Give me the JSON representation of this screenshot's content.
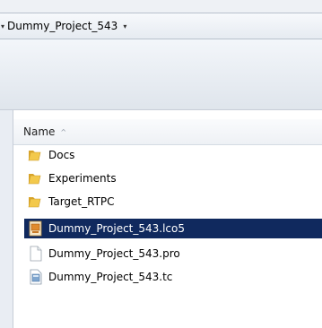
{
  "address": {
    "segment": "Dummy_Project_543",
    "lead_icon": "chevron-right-icon",
    "trail_icon": "dropdown-arrow-icon"
  },
  "columns": {
    "name_label": "Name",
    "sort_icon": "sort-ascending-icon"
  },
  "files": [
    {
      "name": "Docs",
      "icon": "folder-icon",
      "selected": false
    },
    {
      "name": "Experiments",
      "icon": "folder-icon",
      "selected": false
    },
    {
      "name": "Target_RTPC",
      "icon": "folder-icon",
      "selected": false
    },
    {
      "name": "Dummy_Project_543.lco5",
      "icon": "project-file-icon",
      "selected": true
    },
    {
      "name": "Dummy_Project_543.pro",
      "icon": "blank-file-icon",
      "selected": false
    },
    {
      "name": "Dummy_Project_543.tc",
      "icon": "data-file-icon",
      "selected": false
    }
  ],
  "colors": {
    "selection": "#10295e",
    "folder": "#e8b73a"
  }
}
